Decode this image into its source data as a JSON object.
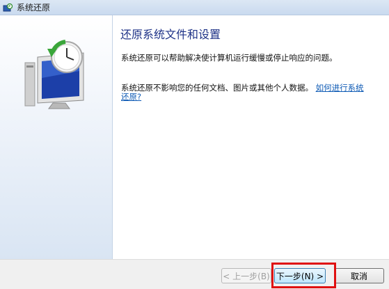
{
  "window": {
    "title": "系统还原"
  },
  "content": {
    "heading": "还原系统文件和设置",
    "description": "系统还原可以帮助解决使计算机运行缓慢或停止响应的问题。",
    "note_text": "系统还原不影响您的任何文档、图片或其他个人数据。",
    "note_link": "如何进行系统还原?"
  },
  "footer": {
    "back_label": "< 上一步(B)",
    "next_label": "下一步(N) >",
    "cancel_label": "取消"
  },
  "colors": {
    "heading": "#1e3287",
    "link": "#0f5bb5",
    "highlight": "#e01010"
  }
}
